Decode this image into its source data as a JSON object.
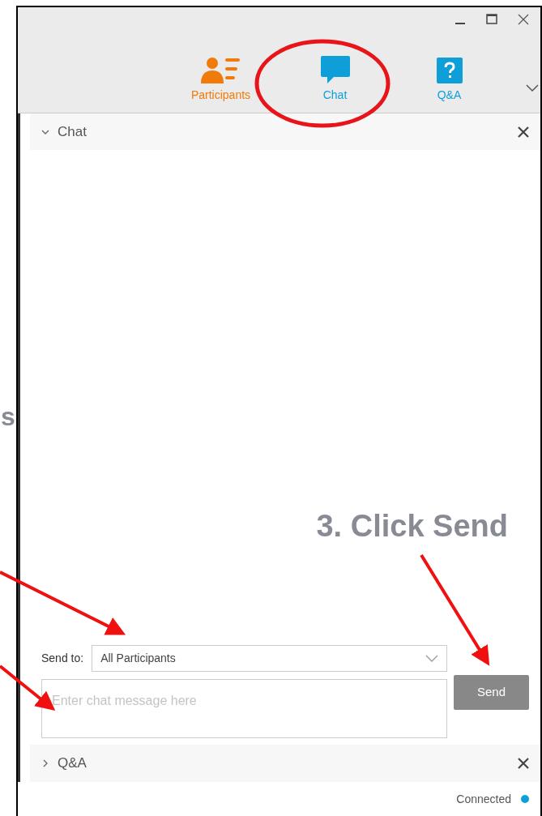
{
  "annotations": {
    "side_text": "s",
    "step_text": "3. Click Send"
  },
  "window": {
    "controls": [
      {
        "kind": "minimize"
      },
      {
        "kind": "maximize"
      },
      {
        "kind": "close"
      }
    ]
  },
  "tabs": [
    {
      "label": "Participants",
      "kind": "participants",
      "color": "#f07a0a"
    },
    {
      "label": "Chat",
      "kind": "chat",
      "color": "#0e9ed8"
    },
    {
      "label": "Q&A",
      "kind": "qa",
      "color": "#0e9ed8"
    }
  ],
  "chat_panel": {
    "title": "Chat",
    "expanded": true,
    "send_to_label": "Send to:",
    "send_to_value": "All Participants",
    "message_placeholder": "Enter chat message here",
    "send_button": "Send"
  },
  "qa_panel": {
    "title": "Q&A",
    "expanded": false
  },
  "status_bar": {
    "text": "Connected",
    "color": "#0e9ed8"
  }
}
